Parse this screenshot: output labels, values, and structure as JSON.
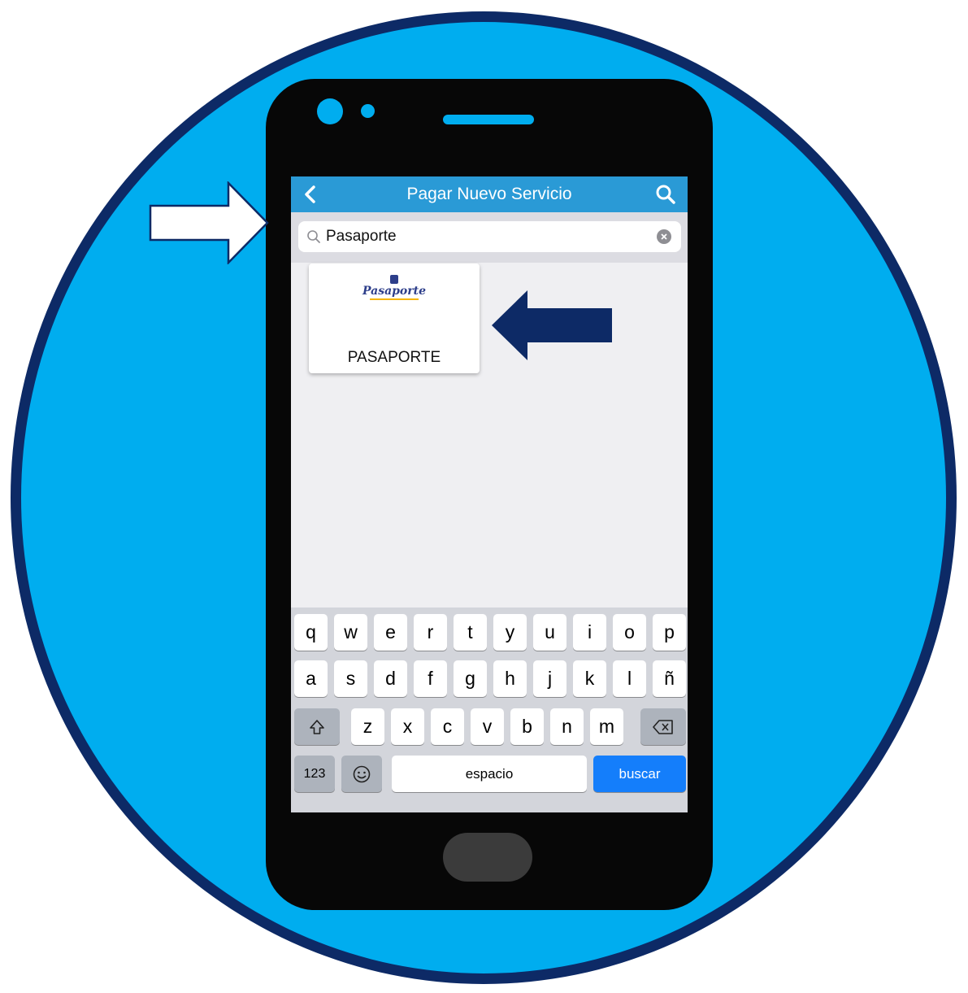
{
  "navbar": {
    "back_icon": "chevron-left-icon",
    "title": "Pagar Nuevo Servicio",
    "search_icon": "search-icon"
  },
  "search": {
    "value": "Pasaporte",
    "icon": "magnifier-icon",
    "clear_icon": "clear-circle-icon"
  },
  "results": [
    {
      "logo_text": "Pasaporte",
      "label": "PASAPORTE"
    }
  ],
  "keyboard": {
    "row1": [
      "q",
      "w",
      "e",
      "r",
      "t",
      "y",
      "u",
      "i",
      "o",
      "p"
    ],
    "row2": [
      "a",
      "s",
      "d",
      "f",
      "g",
      "h",
      "j",
      "k",
      "l",
      "ñ"
    ],
    "row3": [
      "z",
      "x",
      "c",
      "v",
      "b",
      "n",
      "m"
    ],
    "shift_icon": "shift-icon",
    "delete_icon": "backspace-icon",
    "numbers_label": "123",
    "emoji_icon": "emoji-icon",
    "space_label": "espacio",
    "search_label": "buscar"
  },
  "colors": {
    "background_circle": "#00adef",
    "circle_border": "#0d2a66",
    "navbar": "#2a9ad6",
    "search_key": "#147efb",
    "navy_arrow": "#0d2a66"
  },
  "annotations": {
    "pointer_arrow_white": "arrow-right-icon",
    "pointer_arrow_navy": "arrow-left-icon"
  }
}
